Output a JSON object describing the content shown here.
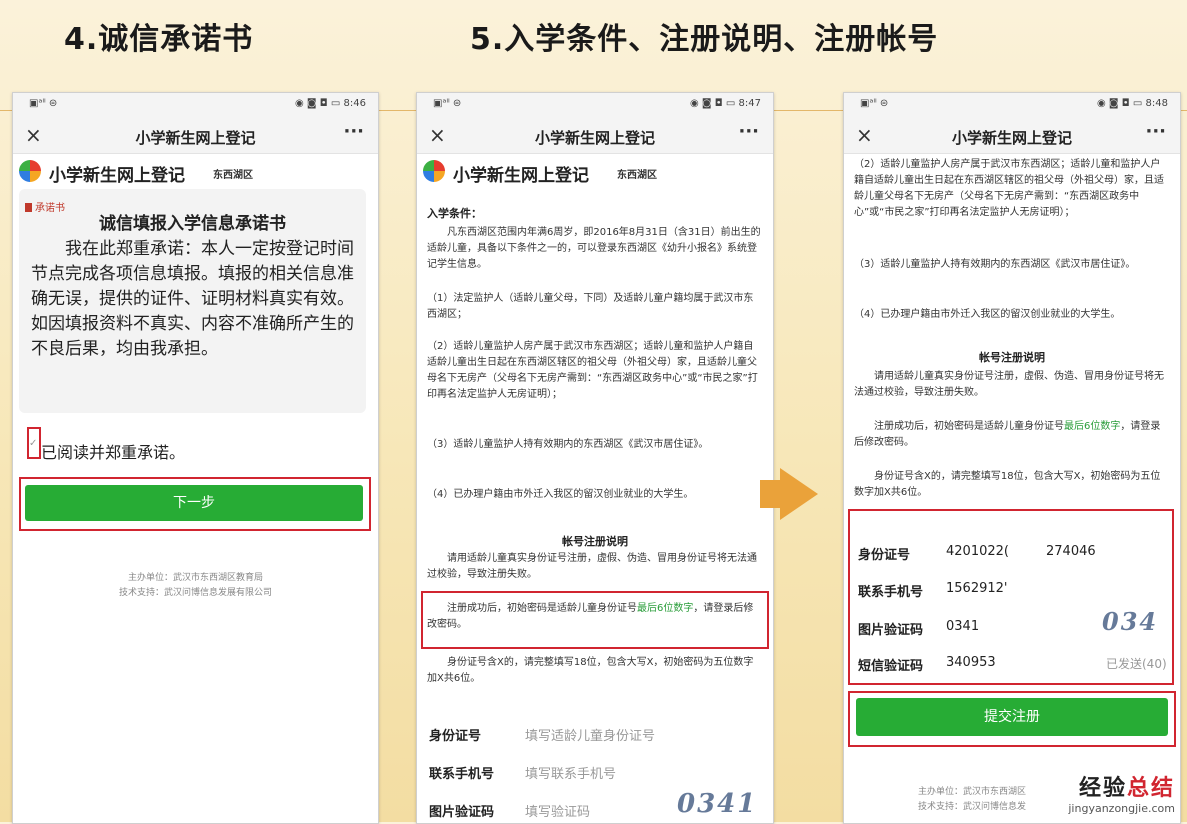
{
  "headings": {
    "step4": "4.诚信承诺书",
    "step5": "5.入学条件、注册说明、注册帐号"
  },
  "common": {
    "status_left": "▣ᵃˡˡ ⊜",
    "close": "×",
    "more": "···",
    "nav_title": "小学新生网上登记",
    "brand_name": "小学新生网上登记",
    "brand_district": "东西湖区"
  },
  "phone1": {
    "time": "8:46",
    "status_right": "◉ ◙ ◘ ▭",
    "tag": "承诺书",
    "card_title": "诚信填报入学信息承诺书",
    "card_body": "我在此郑重承诺：本人一定按登记时间节点完成各项信息填报。填报的相关信息准确无误，提供的证件、证明材料真实有效。如因填报资料不真实、内容不准确所产生的不良后果，均由我承担。",
    "checkbox_tick": "✓",
    "checkbox_label": "已阅读并郑重承诺。",
    "next_button": "下一步",
    "footer_unit": "主办单位：武汉市东西湖区教育局",
    "footer_support": "技术支持：武汉问博信息发展有限公司"
  },
  "phone2": {
    "time": "8:47",
    "status_right": "◉ ◙ ◘ ▭",
    "cond_title": "入学条件：",
    "cond_intro": "凡东西湖区范围内年满6周岁，即2016年8月31日（含31日）前出生的适龄儿童，具备以下条件之一的，可以登录东西湖区《幼升小报名》系统登记学生信息。",
    "cond_1": "（1）法定监护人（适龄儿童父母，下同）及适龄儿童户籍均属于武汉市东西湖区；",
    "cond_2": "（2）适龄儿童监护人房产属于武汉市东西湖区；适龄儿童和监护人户籍自适龄儿童出生日起在东西湖区辖区的祖父母（外祖父母）家，且适龄儿童父母名下无房产（父母名下无房产需到：“东西湖区政务中心”或“市民之家”打印再名法定监护人无房证明）；",
    "cond_3": "（3）适龄儿童监护人持有效期内的东西湖区《武汉市居住证》。",
    "cond_4": "（4）已办理户籍由市外迁入我区的留汉创业就业的大学生。",
    "reg_title": "帐号注册说明",
    "reg_1": "请用适龄儿童真实身份证号注册，虚假、伪造、冒用身份证号将无法通过校验，导致注册失败。",
    "reg_2_pre": "注册成功后，初始密码是适龄儿童身份证号",
    "reg_2_hl": "最后6位数字",
    "reg_2_post": "，请登录后修改密码。",
    "reg_3": "身份证号含X的，请完整填写18位，包含大写X，初始密码为五位数字加X共6位。",
    "form": {
      "id_label": "身份证号",
      "id_placeholder": "填写适龄儿童身份证号",
      "phone_label": "联系手机号",
      "phone_placeholder": "填写联系手机号",
      "captcha_label": "图片验证码",
      "captcha_placeholder": "填写验证码",
      "captcha_image": "0341"
    }
  },
  "phone3": {
    "time": "8:48",
    "status_right": "◉ ◙ ◘ ▭",
    "cond_2": "（2）适龄儿童监护人房产属于武汉市东西湖区；适龄儿童和监护人户籍自适龄儿童出生日起在东西湖区辖区的祖父母（外祖父母）家，且适龄儿童父母名下无房产（父母名下无房产需到：“东西湖区政务中心”或“市民之家”打印再名法定监护人无房证明）；",
    "cond_3": "（3）适龄儿童监护人持有效期内的东西湖区《武汉市居住证》。",
    "cond_4": "（4）已办理户籍由市外迁入我区的留汉创业就业的大学生。",
    "reg_title": "帐号注册说明",
    "reg_1": "请用适龄儿童真实身份证号注册，虚假、伪造、冒用身份证号将无法通过校验，导致注册失败。",
    "reg_2_pre": "注册成功后，初始密码是适龄儿童身份证号",
    "reg_2_hl": "最后6位数字",
    "reg_2_post": "，请登录后修改密码。",
    "reg_3": "身份证号含X的，请完整填写18位，包含大写X，初始密码为五位数字加X共6位。",
    "form": {
      "id_label": "身份证号",
      "id_value_a": "4201022(",
      "id_value_b": "274046",
      "phone_label": "联系手机号",
      "phone_value": "1562912'",
      "captcha_label": "图片验证码",
      "captcha_value": "0341",
      "captcha_image": "034",
      "sms_label": "短信验证码",
      "sms_value": "340953",
      "sms_status": "已发送(40)"
    },
    "submit_button": "提交注册",
    "footer_unit": "主办单位：武汉市东西湖区",
    "footer_support": "技术支持：武汉问博信息发"
  },
  "watermark": {
    "brand_a": "经验",
    "brand_b": "总结",
    "url": "jingyanzongjie.com"
  }
}
